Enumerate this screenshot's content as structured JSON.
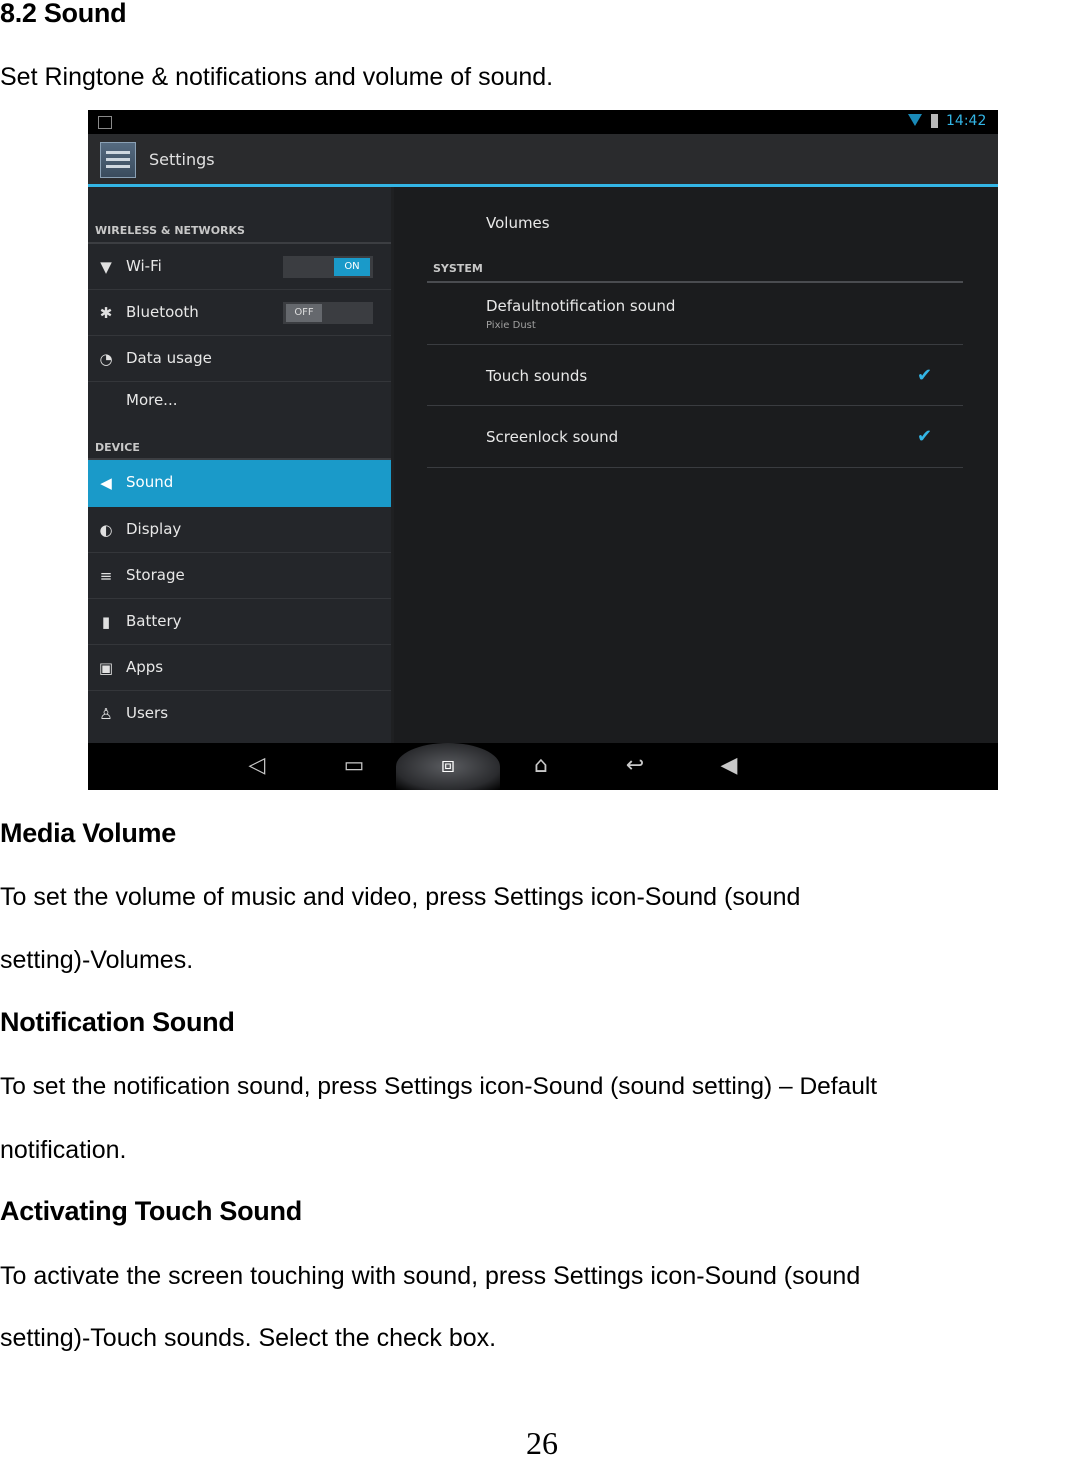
{
  "section_title": "8.2 Sound",
  "intro": "Set Ringtone & notifications and volume of sound.",
  "screenshot": {
    "status_time": "14:42",
    "app_title": "Settings",
    "categories": {
      "wireless": "WIRELESS & NETWORKS",
      "device": "DEVICE"
    },
    "menu": {
      "wifi": "Wi-Fi",
      "wifi_toggle": "ON",
      "bluetooth": "Bluetooth",
      "bluetooth_toggle": "OFF",
      "data_usage": "Data usage",
      "more": "More...",
      "sound": "Sound",
      "display": "Display",
      "storage": "Storage",
      "battery": "Battery",
      "apps": "Apps",
      "users": "Users"
    },
    "right": {
      "volumes": "Volumes",
      "system": "SYSTEM",
      "default_notification": "Defaultnotification sound",
      "default_notification_value": "Pixie Dust",
      "touch_sounds": "Touch sounds",
      "screen_lock": "Screenlock sound"
    }
  },
  "sections": {
    "media_volume": {
      "title": "Media Volume",
      "line1": "To set the volume of music and video, press Settings icon-Sound (sound",
      "line2": "setting)-Volumes."
    },
    "notification_sound": {
      "title": "Notification Sound",
      "line1": "To set the notification sound, press Settings icon-Sound (sound setting) – Default",
      "line2": "notification."
    },
    "touch_sound": {
      "title": "Activating Touch Sound",
      "line1": "To activate the screen touching with sound, press Settings icon-Sound (sound",
      "line2": "setting)-Touch sounds. Select the check box."
    }
  },
  "page_number": "26"
}
